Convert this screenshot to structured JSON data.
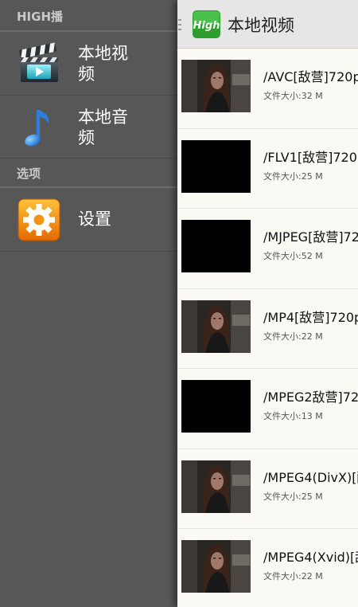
{
  "drawer": {
    "section_main": "HIGH播",
    "items": [
      {
        "label": "本地视\n频",
        "icon": "clapperboard-icon"
      },
      {
        "label": "本地音\n频",
        "icon": "music-note-icon"
      }
    ],
    "section_options": "选项",
    "settings": {
      "label": "设置",
      "icon": "settings-gear-icon"
    }
  },
  "actionbar": {
    "title": "本地视频",
    "app_icon": "high-app-logo-icon",
    "menu_icon": "drawer-toggle-icon"
  },
  "size_label": "文件大小:",
  "videos": [
    {
      "name": "/AVC[敌营]720p.",
      "size": "32 M",
      "thumb": "frame"
    },
    {
      "name": "/FLV1[敌营]720p",
      "size": "25 M",
      "thumb": "black"
    },
    {
      "name": "/MJPEG[敌营]72",
      "size": "52 M",
      "thumb": "black"
    },
    {
      "name": "/MP4[敌营]720p",
      "size": "22 M",
      "thumb": "frame"
    },
    {
      "name": "/MPEG2敌营]72(",
      "size": "13 M",
      "thumb": "black"
    },
    {
      "name": "/MPEG4(DivX)[酎",
      "size": "25 M",
      "thumb": "frame"
    },
    {
      "name": "/MPEG4(Xvid)[敌",
      "size": "22 M",
      "thumb": "frame"
    }
  ],
  "colors": {
    "drawer_bg": "#575757",
    "content_bg": "#faf9f4",
    "actionbar_bg": "#e6e6e6",
    "brand_green": "#3aa53a"
  }
}
